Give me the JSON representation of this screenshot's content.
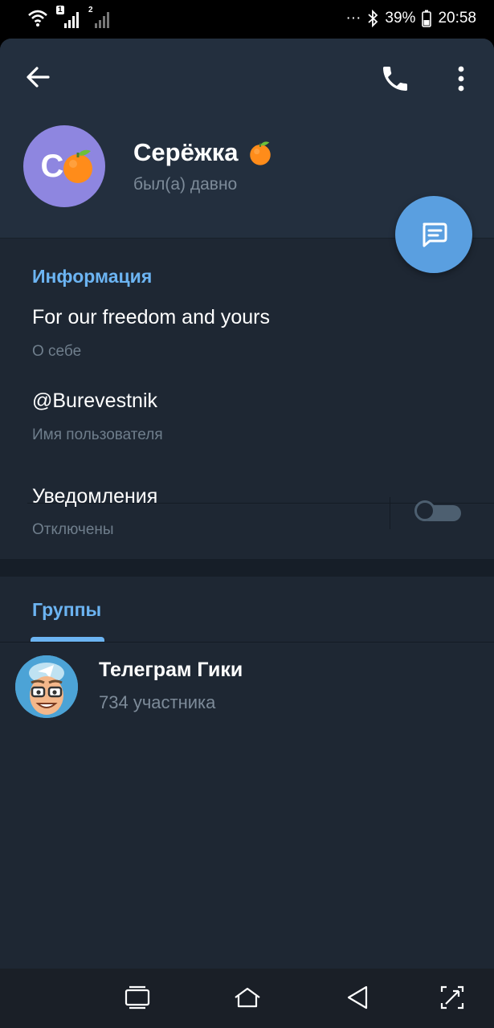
{
  "status_bar": {
    "sim1": "1",
    "sim2": "2",
    "dots": "···",
    "battery": "39%",
    "time": "20:58"
  },
  "profile": {
    "initial": "C",
    "name": "Серёжка",
    "last_seen": "был(а) давно"
  },
  "info": {
    "title": "Информация",
    "bio": "For our freedom and yours",
    "bio_label": "О себе",
    "username": "@Burevestnik",
    "username_label": "Имя пользователя",
    "notifications": "Уведомления",
    "notifications_state": "Отключены",
    "notifications_enabled": false
  },
  "groups_tab": {
    "label": "Группы",
    "items": [
      {
        "name": "Телеграм Гики",
        "members": "734 участника"
      }
    ]
  },
  "colors": {
    "accent": "#6cb4f2",
    "fab": "#5a9fe0",
    "avatar": "#8e86e0",
    "background": "#1e2733"
  }
}
